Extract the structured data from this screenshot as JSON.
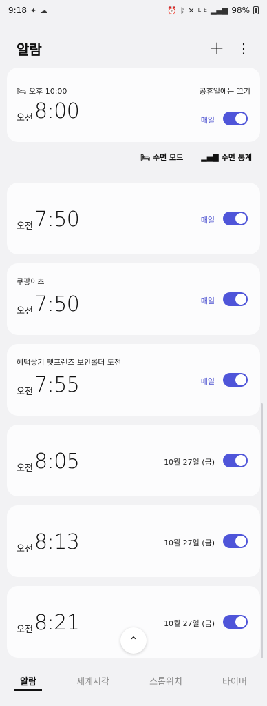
{
  "status_bar": {
    "time": "9:18",
    "network": "LTE",
    "battery": "98%"
  },
  "header": {
    "title": "알람"
  },
  "bedtime_alarm": {
    "bedtime": "오후 10:00",
    "holiday_text": "공휴일에는 끄기",
    "ampm": "오전",
    "time": "8:00",
    "repeat": "매일",
    "enabled": true
  },
  "sleep_links": {
    "sleep_mode": "수면 모드",
    "sleep_stats": "수면 통계"
  },
  "alarms": [
    {
      "label": "",
      "ampm": "오전",
      "time": "7:50",
      "repeat": "매일",
      "enabled": true
    },
    {
      "label": "쿠팡이츠",
      "ampm": "오전",
      "time": "7:50",
      "repeat": "매일",
      "enabled": true
    },
    {
      "label": "혜택쌓기 펫프랜즈 보안롤더 도전",
      "ampm": "오전",
      "time": "7:55",
      "repeat": "매일",
      "enabled": true
    },
    {
      "label": "",
      "ampm": "오전",
      "time": "8:05",
      "date": "10월 27일 (금)",
      "enabled": true
    },
    {
      "label": "",
      "ampm": "오전",
      "time": "8:13",
      "date": "10월 27일 (금)",
      "enabled": true
    },
    {
      "label": "",
      "ampm": "오전",
      "time": "8:21",
      "date": "10월 27일 (금)",
      "enabled": true
    }
  ],
  "bottom_nav": {
    "tabs": [
      "알람",
      "세계시각",
      "스톱워치",
      "타이머"
    ],
    "active": "알람"
  },
  "colors": {
    "accent": "#4f55d9",
    "background": "#f2f2f4",
    "card": "#fcfcfd"
  }
}
